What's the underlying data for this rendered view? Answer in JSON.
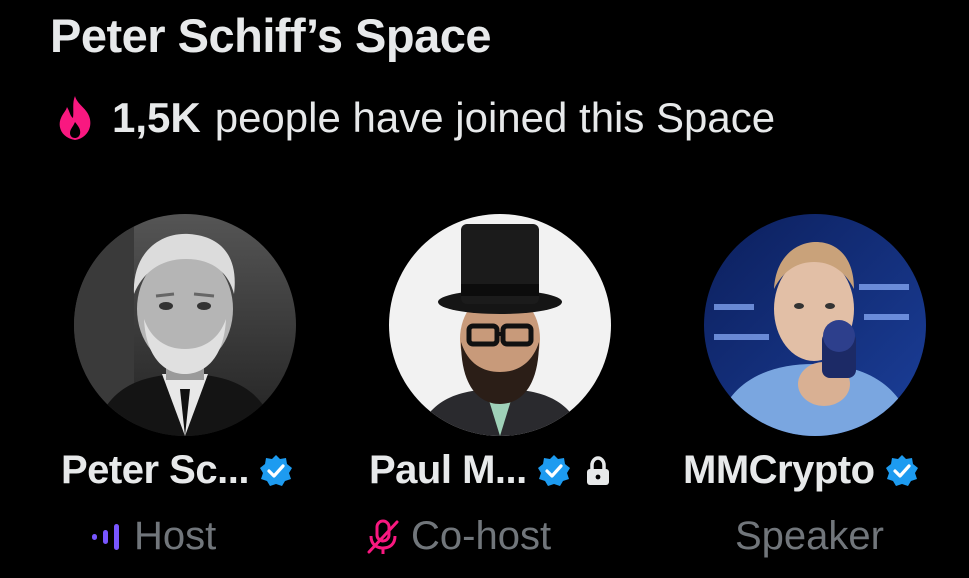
{
  "space": {
    "title": "Peter Schiff’s Space",
    "joined_count": "1,5K",
    "joined_text": "people have joined this Space",
    "fire_color": "#f91880"
  },
  "participants": [
    {
      "name": "Peter Sc...",
      "role": "Host",
      "verified": true,
      "role_icon": "speaking-bars-icon",
      "role_icon_color": "#7856ff"
    },
    {
      "name": "Paul M...",
      "role": "Co-host",
      "verified": true,
      "locked": true,
      "role_icon": "mic-muted-icon",
      "role_icon_color": "#f91880"
    },
    {
      "name": "MMCrypto",
      "role": "Speaker",
      "verified": true
    }
  ],
  "colors": {
    "background": "#000000",
    "text_primary": "#e7e9ea",
    "text_secondary": "#71767b",
    "verified_blue": "#1d9bf0"
  }
}
